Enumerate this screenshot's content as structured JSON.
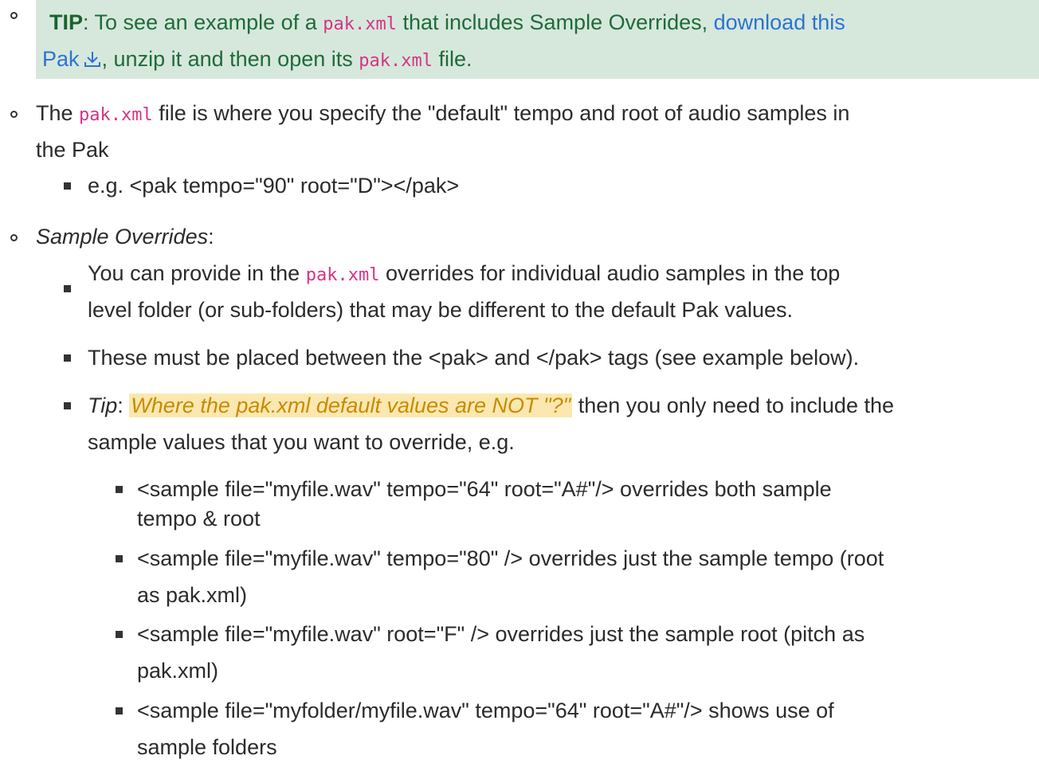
{
  "tip": {
    "label": "TIP",
    "text1": ": To see an example of a ",
    "code1": "pak.xml",
    "text2": " that includes Sample Overrides, ",
    "link1": "download this",
    "link2": "Pak",
    "text3": ", unzip it and then open its ",
    "code2": "pak.xml",
    "text4": " file."
  },
  "item1": {
    "pre": "The ",
    "code": "pak.xml",
    "line1": " file is where you specify the \"default\" tempo and root of audio samples in",
    "line2": "the Pak",
    "example": "e.g. <pak tempo=\"90\" root=\"D\"></pak>"
  },
  "item2": {
    "heading": "Sample Overrides",
    "colon": ":",
    "sub1_pre": "You can provide in the ",
    "sub1_code": "pak.xml",
    "sub1_line1": " overrides for individual audio samples in the top",
    "sub1_line2": "level folder (or sub-folders) that may be different to the default Pak values.",
    "sub2": "These must be placed between the <pak> and </pak> tags (see example below).",
    "sub3_label": "Tip",
    "sub3_colon": ": ",
    "sub3_highlight": "Where the pak.xml default values are NOT \"?\"",
    "sub3_line1": " then you only need to include the",
    "sub3_line2": "sample values that you want to override, e.g.",
    "examples": [
      {
        "line1": "<sample file=\"myfile.wav\" tempo=\"64\" root=\"A#\"/> overrides both sample",
        "line2": "tempo & root"
      },
      {
        "line1": "<sample file=\"myfile.wav\" tempo=\"80\" /> overrides just the sample tempo (root",
        "line2": "as pak.xml)"
      },
      {
        "line1": "<sample file=\"myfile.wav\" root=\"F\" /> overrides just the sample root (pitch as",
        "line2": "pak.xml)"
      },
      {
        "line1": "<sample file=\"myfolder/myfile.wav\" tempo=\"64\" root=\"A#\"/> shows use of",
        "line2": "sample folders"
      }
    ]
  },
  "icons": {
    "download": "download-icon"
  },
  "colors": {
    "tip_bg": "#d6e8dc",
    "tip_text": "#1f6b3a",
    "link": "#2c73d2",
    "code": "#d63384",
    "highlight_bg": "#fbe8b0",
    "highlight_text": "#c98a00"
  }
}
